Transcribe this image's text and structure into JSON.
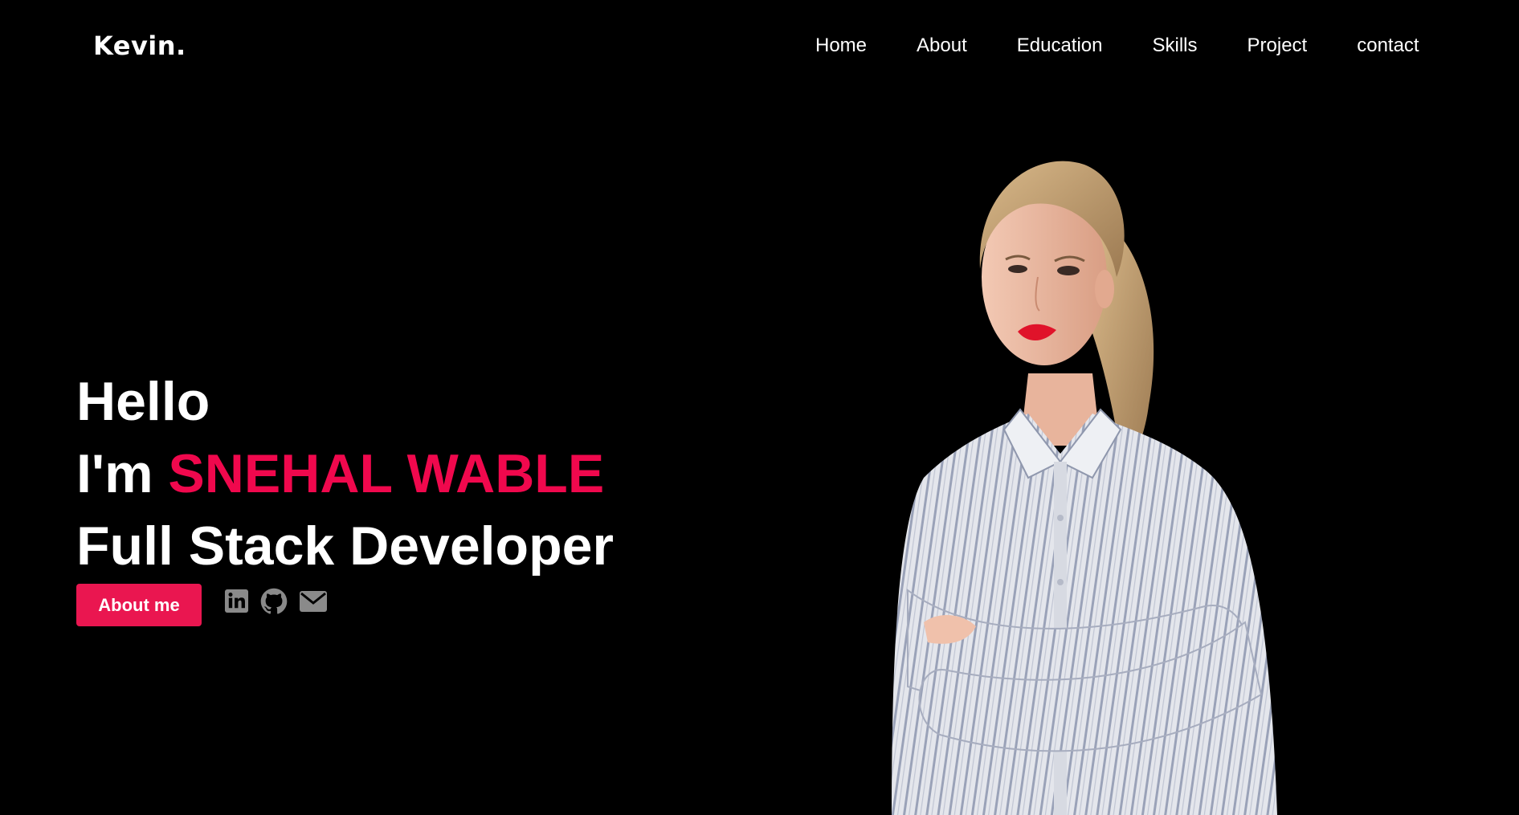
{
  "brand": {
    "logo": "Kevin."
  },
  "nav": {
    "items": [
      {
        "label": "Home"
      },
      {
        "label": "About"
      },
      {
        "label": "Education"
      },
      {
        "label": "Skills"
      },
      {
        "label": "Project"
      },
      {
        "label": "contact"
      }
    ]
  },
  "hero": {
    "greeting": "Hello",
    "intro_prefix": "I'm ",
    "name": "SNEHAL WABLE",
    "role": "Full Stack Developer",
    "cta_label": "About me"
  },
  "socials": {
    "icons": [
      "linkedin-icon",
      "github-icon",
      "envelope-icon"
    ]
  },
  "colors": {
    "background": "#000000",
    "accent": "#f0084d",
    "button": "#ea1650",
    "icon": "#8a8a8a"
  }
}
